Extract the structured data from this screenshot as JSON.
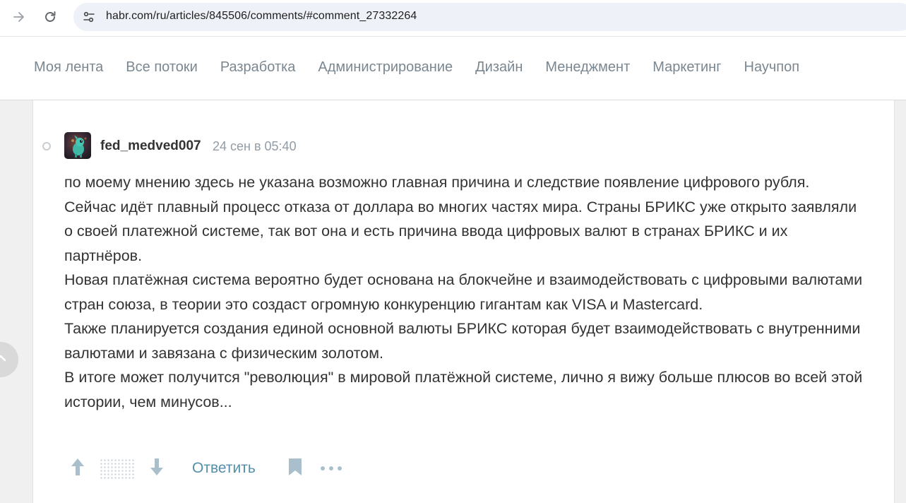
{
  "browser": {
    "url": "habr.com/ru/articles/845506/comments/#comment_27332264",
    "forward_icon": "arrow-forward-icon",
    "reload_icon": "reload-icon",
    "site_info_icon": "site-settings-icon"
  },
  "nav": {
    "items": [
      {
        "label": "Моя лента"
      },
      {
        "label": "Все потоки"
      },
      {
        "label": "Разработка"
      },
      {
        "label": "Администрирование"
      },
      {
        "label": "Дизайн"
      },
      {
        "label": "Менеджмент"
      },
      {
        "label": "Маркетинг"
      },
      {
        "label": "Научпоп"
      }
    ]
  },
  "comment": {
    "username": "fed_medved007",
    "timestamp": "24 сен в 05:40",
    "paragraphs": [
      "по моему мнению здесь не указана возможно главная причина и следствие появление цифрового рубля.",
      "Сейчас идёт плавный процесс отказа от доллара во многих частях мира. Страны БРИКС уже открыто заявляли о своей платежной системе, так вот она и есть причина ввода цифровых валют в странах БРИКС и их партнёров.",
      "Новая платёжная система вероятно будет основана на блокчейне и взаимодействовать с цифровыми валютами стран союза, в теории это создаст огромную конкуренцию гигантам как VISA и Mastercard.",
      "Также планируется создания единой основной валюты БРИКС которая будет взаимодействовать с внутренними валютами и завязана с физическим золотом.",
      "В итоге может получится \"революция\" в мировой платёжной системе, лично я вижу больше плюсов во всей этой истории, чем минусов..."
    ],
    "actions": {
      "reply_label": "Ответить",
      "upvote_icon": "arrow-up-icon",
      "downvote_icon": "arrow-down-icon",
      "bookmark_icon": "bookmark-icon",
      "more_icon": "more-dots-icon"
    }
  },
  "colors": {
    "accent": "#548eaa",
    "nav_text": "#7b8790",
    "body_text": "#333333",
    "muted": "#929ca5"
  }
}
